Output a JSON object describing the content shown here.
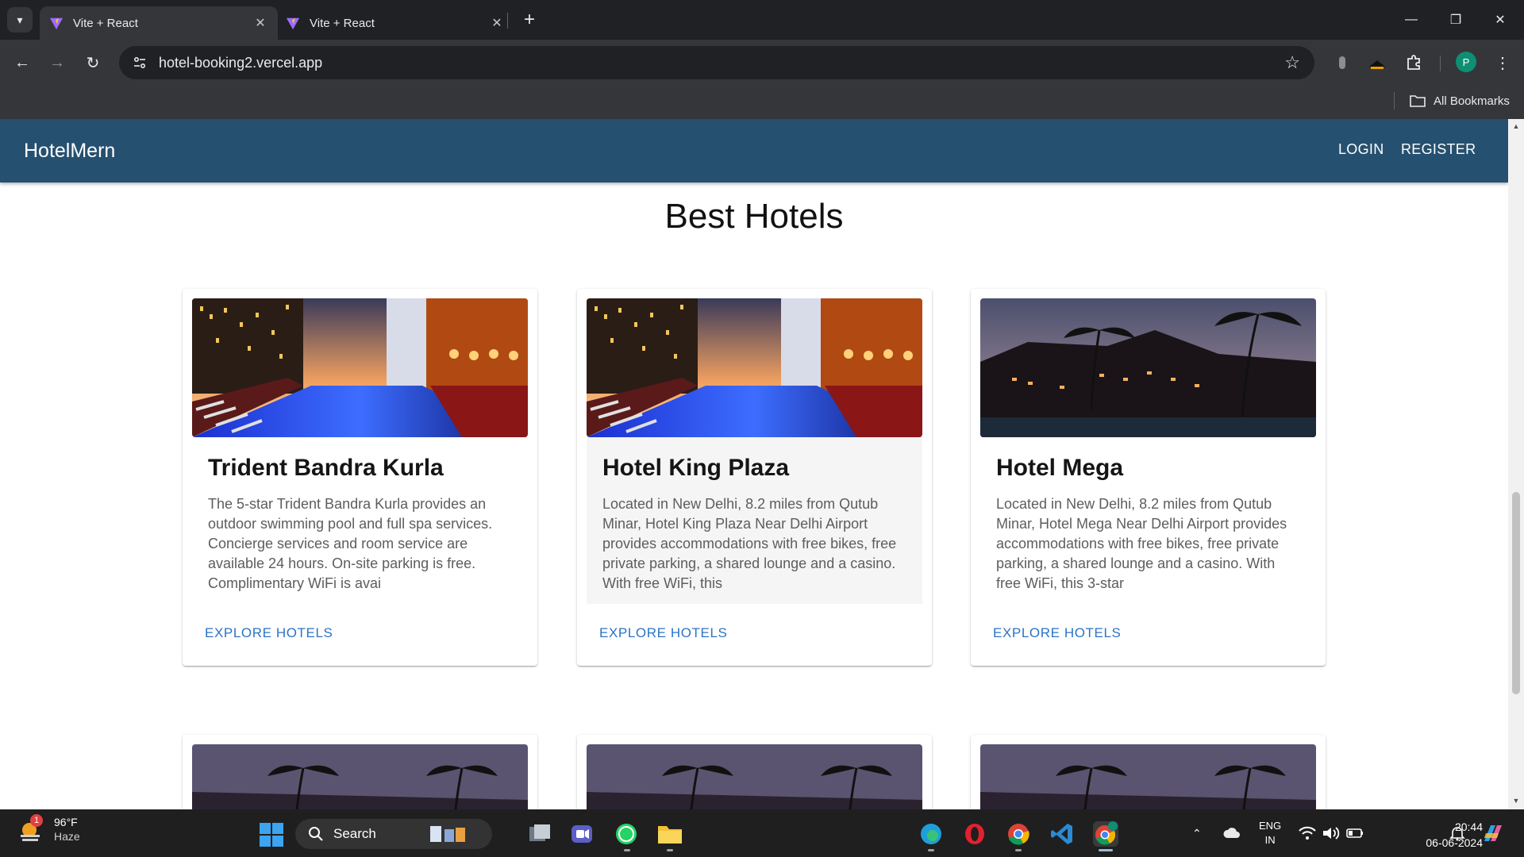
{
  "browser": {
    "tabs": [
      {
        "title": "Vite + React",
        "active": true
      },
      {
        "title": "Vite + React",
        "active": false
      }
    ],
    "url": "hotel-booking2.vercel.app",
    "bookmarks_label": "All Bookmarks",
    "profile_initial": "P"
  },
  "app": {
    "brand": "HotelMern",
    "nav": {
      "login": "LOGIN",
      "register": "REGISTER"
    },
    "colors": {
      "appbar": "#265070",
      "action": "#2c73c6"
    }
  },
  "section": {
    "title": "Best Hotels"
  },
  "hotels": [
    {
      "name": "Trident Bandra Kurla",
      "description": "The 5-star Trident Bandra Kurla provides an outdoor swimming pool and full spa services. Concierge services and room service are available 24 hours. On-site parking is free. Complimentary WiFi is avai",
      "action": "EXPLORE HOTELS",
      "image": "rooftop-pool"
    },
    {
      "name": "Hotel King Plaza",
      "description": "Located in New Delhi, 8.2 miles from Qutub Minar, Hotel King Plaza Near Delhi Airport provides accommodations with free bikes, free private parking, a shared lounge and a casino. With free WiFi, this",
      "action": "EXPLORE HOTELS",
      "image": "rooftop-pool"
    },
    {
      "name": "Hotel Mega",
      "description": "Located in New Delhi, 8.2 miles from Qutub Minar, Hotel Mega Near Delhi Airport provides accommodations with free bikes, free private parking, a shared lounge and a casino. With free WiFi, this 3-star",
      "action": "EXPLORE HOTELS",
      "image": "palm-resort-dusk"
    }
  ],
  "taskbar": {
    "weather": {
      "temp": "96°F",
      "condition": "Haze",
      "badge": "1"
    },
    "search_label": "Search",
    "language": {
      "line1": "ENG",
      "line2": "IN"
    },
    "time": "20:44",
    "date": "06-06-2024"
  }
}
